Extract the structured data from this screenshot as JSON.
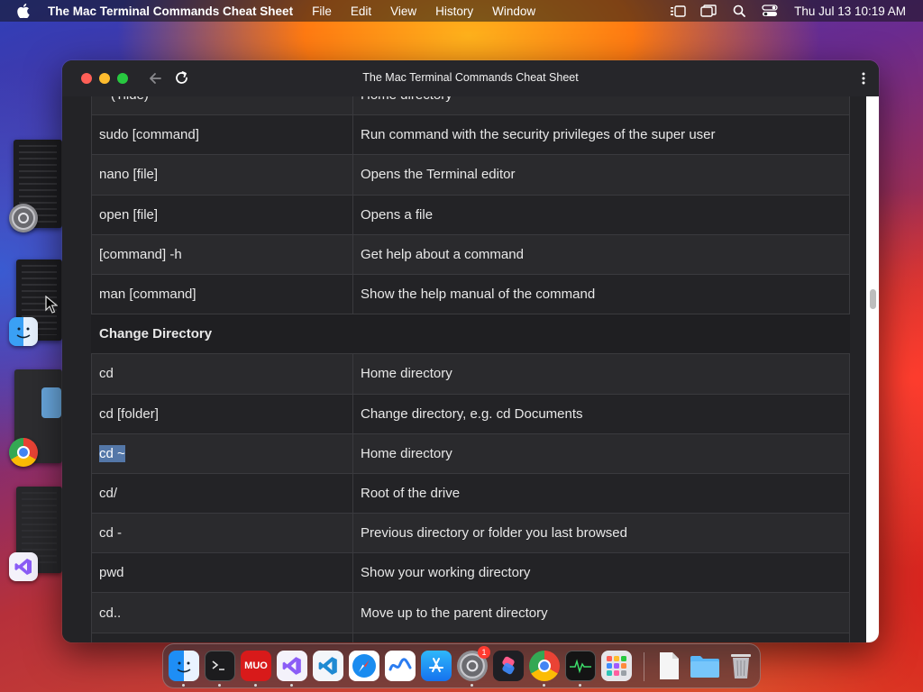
{
  "menubar": {
    "app_name": "The Mac Terminal Commands Cheat Sheet",
    "menus": [
      "File",
      "Edit",
      "View",
      "History",
      "Window"
    ],
    "clock": "Thu Jul 13  10:19 AM"
  },
  "window": {
    "title": "The Mac Terminal Commands Cheat Sheet"
  },
  "table": {
    "partial_top": {
      "cmd": "~ (Tilde)",
      "desc": "Home directory"
    },
    "rows_before_section": [
      {
        "cmd": "sudo [command]",
        "desc": "Run command with the security privileges of the super user"
      },
      {
        "cmd": "nano [file]",
        "desc": "Opens the Terminal editor"
      },
      {
        "cmd": "open [file]",
        "desc": "Opens a file"
      },
      {
        "cmd": "[command] -h",
        "desc": "Get help about a command"
      },
      {
        "cmd": "man [command]",
        "desc": "Show the help manual of the command"
      }
    ],
    "section_title": "Change Directory",
    "rows_after_section": [
      {
        "cmd": "cd",
        "desc": "Home directory"
      },
      {
        "cmd": "cd [folder]",
        "desc": "Change directory, e.g. cd Documents"
      },
      {
        "cmd": "cd ~",
        "desc": "Home directory",
        "selected": true
      },
      {
        "cmd": "cd/",
        "desc": "Root of the drive"
      },
      {
        "cmd": "cd -",
        "desc": "Previous directory or folder you last browsed"
      },
      {
        "cmd": "pwd",
        "desc": "Show your working directory"
      },
      {
        "cmd": "cd..",
        "desc": "Move up to the parent directory"
      }
    ]
  },
  "dock": {
    "apps": [
      "finder-icon",
      "terminal-icon",
      "mudo-icon",
      "visual-studio-icon",
      "vscode-icon",
      "safari-icon",
      "freeform-icon",
      "app-store-icon",
      "system-settings-icon",
      "shortcuts-icon",
      "chrome-icon",
      "activity-monitor-icon",
      "launchpad-icon",
      "document-icon",
      "downloads-folder-icon",
      "trash-icon"
    ],
    "mudo_label": "MUO",
    "settings_badge": "1"
  },
  "colors": {
    "accent_selection": "#5477a8",
    "window_bg": "#202124",
    "traffic_red": "#fe5f57",
    "traffic_yellow": "#febc2e",
    "traffic_green": "#28c840"
  }
}
